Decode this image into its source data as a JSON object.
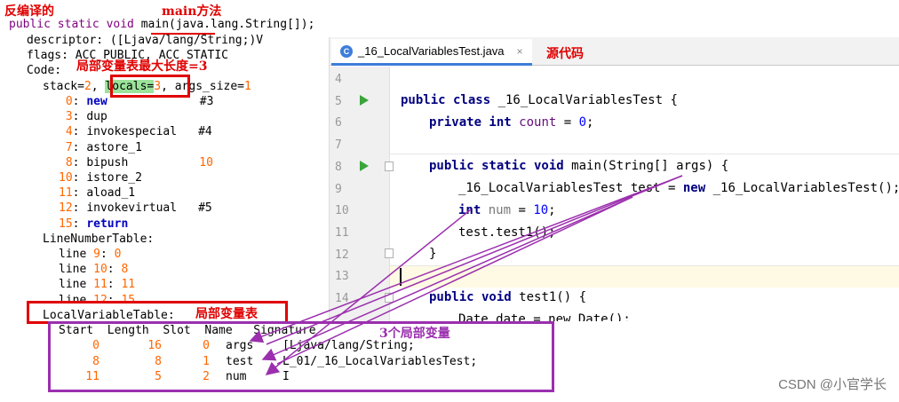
{
  "annotations": {
    "decompiled": "反编译的",
    "main_method": "main方法",
    "locals_max": "局部变量表最大长度=3",
    "source_code": "源代码",
    "local_var_table": "局部变量表",
    "three_locals": "3个局部变量"
  },
  "bytecode": {
    "signature_prefix": "public static void ",
    "signature_name": "main",
    "signature_suffix": "(java.lang.String[]);",
    "descriptor": "descriptor: ([Ljava/lang/String;)V",
    "flags": "flags: ACC_PUBLIC, ACC_STATIC",
    "code_label": "Code:",
    "stack_prefix": "stack=",
    "stack_val": "2",
    "locals_label": "locals",
    "locals_val": "3",
    "args_size_prefix": ", args_size=",
    "args_size_val": "1",
    "instructions": [
      {
        "idx": "0",
        "op": "new",
        "arg": "#3",
        "bold": true
      },
      {
        "idx": "3",
        "op": "dup",
        "arg": ""
      },
      {
        "idx": "4",
        "op": "invokespecial",
        "arg": "#4"
      },
      {
        "idx": "7",
        "op": "astore_1",
        "arg": ""
      },
      {
        "idx": "8",
        "op": "bipush",
        "arg": "10"
      },
      {
        "idx": "10",
        "op": "istore_2",
        "arg": ""
      },
      {
        "idx": "11",
        "op": "aload_1",
        "arg": ""
      },
      {
        "idx": "12",
        "op": "invokevirtual",
        "arg": "#5"
      },
      {
        "idx": "15",
        "op": "return",
        "arg": "",
        "bold": true
      }
    ],
    "line_number_table_label": "LineNumberTable:",
    "line_numbers": [
      {
        "line": "9",
        "pc": "0"
      },
      {
        "line": "10",
        "pc": "8"
      },
      {
        "line": "11",
        "pc": "11"
      },
      {
        "line": "12",
        "pc": "15"
      }
    ],
    "local_variable_table_label": "LocalVariableTable:",
    "lvt_headers": [
      "Start",
      "Length",
      "Slot",
      "Name",
      "Signature"
    ],
    "lvt_rows": [
      {
        "start": "0",
        "length": "16",
        "slot": "0",
        "name": "args",
        "signature": "[Ljava/lang/String;"
      },
      {
        "start": "8",
        "length": "8",
        "slot": "1",
        "name": "test",
        "signature": "L_01/_16_LocalVariablesTest;"
      },
      {
        "start": "11",
        "length": "5",
        "slot": "2",
        "name": "num",
        "signature": "I"
      }
    ]
  },
  "ide": {
    "tab_label": "_16_LocalVariablesTest.java",
    "tab_close": "×",
    "tab_icon_letter": "C",
    "line_numbers": [
      "4",
      "5",
      "6",
      "7",
      "8",
      "9",
      "10",
      "11",
      "12",
      "13",
      "14"
    ],
    "code": {
      "l5_kw": "public class ",
      "l5_rest": "_16_LocalVariablesTest {",
      "l6_kw": "private int ",
      "l6_var": "count",
      "l6_eq": " = ",
      "l6_num": "0",
      "l6_end": ";",
      "l8_kw": "public static void ",
      "l8_rest": "main(String[] args) {",
      "l9_pre": "_16_LocalVariablesTest test = ",
      "l9_kw": "new ",
      "l9_rest": "_16_LocalVariablesTest();",
      "l10_kw": "int ",
      "l10_var": "num",
      "l10_eq": " = ",
      "l10_num": "10",
      "l10_end": ";",
      "l11": "test.test1();",
      "l12": "}",
      "l14_kw": "public void ",
      "l14_rest": "test1() {",
      "l15_partial": "Date date = new Date();"
    }
  },
  "watermark": "CSDN @小官学长",
  "colors": {
    "annotation_red": "#e00000",
    "annotation_purple": "#9b2fae",
    "bytecode_keyword": "#0000c0",
    "bytecode_number": "#ff6600",
    "locals_highlight": "#9be39b",
    "ide_keyword": "#000080",
    "run_icon": "#3aa53a",
    "tab_accent": "#3d7ddb"
  }
}
